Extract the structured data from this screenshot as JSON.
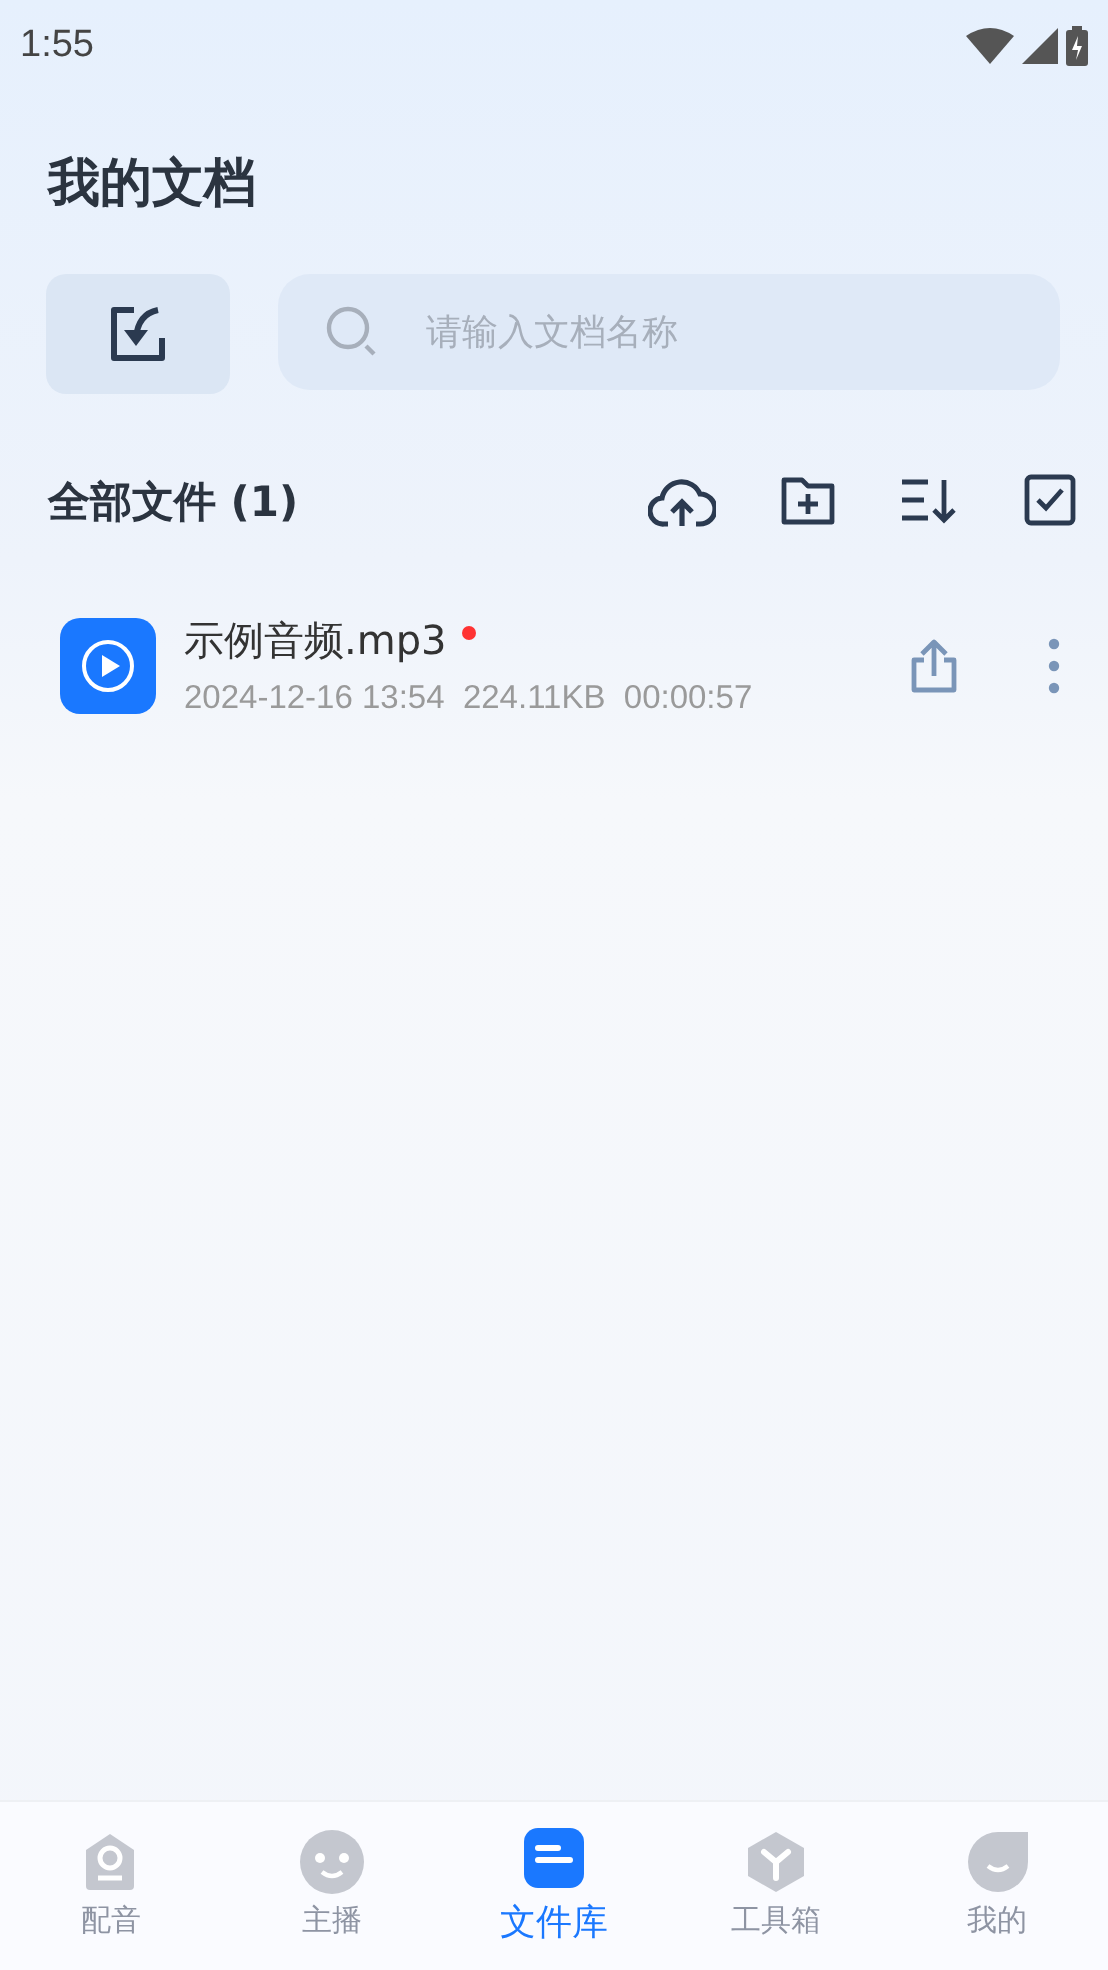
{
  "status_bar": {
    "time": "1:55"
  },
  "title": "我的文档",
  "search": {
    "placeholder": "请输入文档名称"
  },
  "section": {
    "title": "全部文件 (1)"
  },
  "files": [
    {
      "name": "示例音频.mp3",
      "new": true,
      "date": "2024-12-16 13:54",
      "size": "224.11KB",
      "duration": "00:00:57"
    }
  ],
  "nav": [
    {
      "kind": "mic",
      "label": "配音",
      "selected": false
    },
    {
      "kind": "face",
      "label": "主播",
      "selected": false
    },
    {
      "kind": "doc",
      "label": "文件库",
      "selected": true
    },
    {
      "kind": "box",
      "label": "工具箱",
      "selected": false
    },
    {
      "kind": "me",
      "label": "我的",
      "selected": false
    }
  ]
}
